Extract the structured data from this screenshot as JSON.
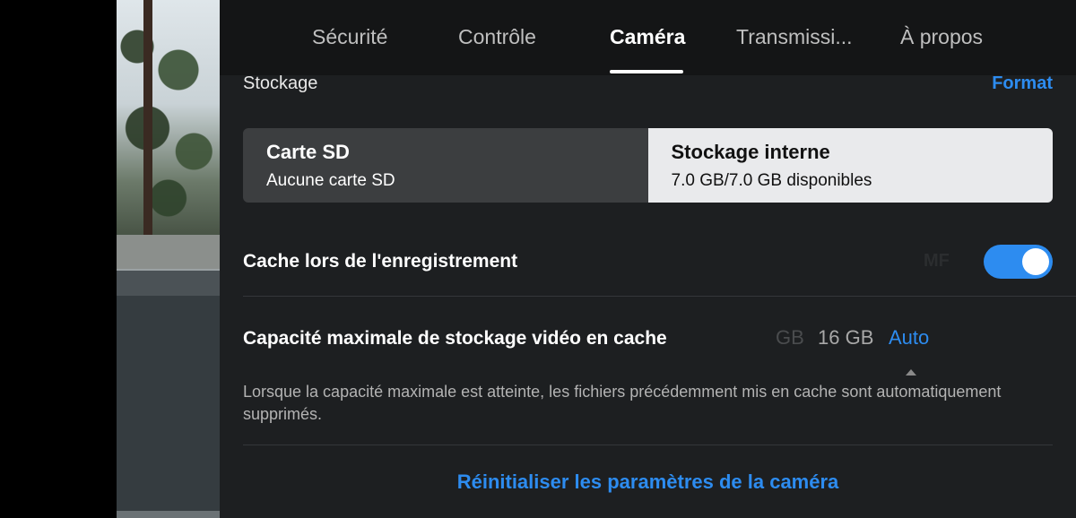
{
  "tabs": [
    {
      "label": "Sécurité",
      "active": false
    },
    {
      "label": "Contrôle",
      "active": false
    },
    {
      "label": "Caméra",
      "active": true
    },
    {
      "label": "Transmissi...",
      "active": false
    },
    {
      "label": "À propos",
      "active": false
    }
  ],
  "storage": {
    "section_label": "Stockage",
    "format_label": "Format",
    "options": [
      {
        "title": "Carte SD",
        "subtitle": "Aucune carte SD",
        "selected": false
      },
      {
        "title": "Stockage interne",
        "subtitle": "7.0 GB/7.0 GB disponibles",
        "selected": true
      }
    ]
  },
  "cache_recording": {
    "label": "Cache lors de l'enregistrement",
    "enabled": true,
    "ghost_text": "MF"
  },
  "max_capacity": {
    "label": "Capacité maximale de stockage vidéo en cache",
    "options": [
      "GB",
      "16 GB",
      "Auto"
    ],
    "selected": "Auto",
    "description": "Lorsque la capacité maximale est atteinte, les fichiers précédemment mis en cache sont automatiquement supprimés."
  },
  "reset_label": "Réinitialiser les paramètres de la caméra",
  "colors": {
    "accent": "#2d8cf0",
    "panel_bg": "#1d1f21",
    "tabbar_bg": "#141516"
  }
}
